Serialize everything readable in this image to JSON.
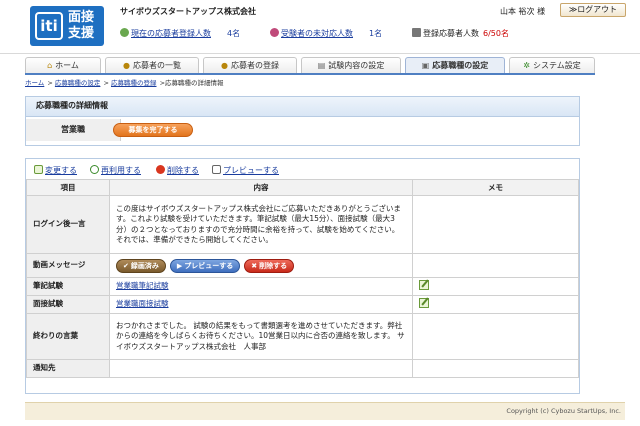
{
  "header": {
    "logo_mark": "iti",
    "logo_text_line1": "面接",
    "logo_text_line2": "支援",
    "company": "サイボウズスタートアップス株式会社",
    "user": "山本 裕次 様",
    "logout_label": "≫ログアウト"
  },
  "stats": {
    "current_applicants_label": "現在の応募者登録人数",
    "current_applicants_count": "4名",
    "unhandled_label": "受験者の未対応人数",
    "unhandled_count": "1名",
    "registered_label": "登録応募者人数",
    "registered_value": "6/50名"
  },
  "nav": {
    "tabs": [
      {
        "label": "ホーム",
        "icon": "home-icon"
      },
      {
        "label": "応募者の一覧",
        "icon": "people-icon"
      },
      {
        "label": "応募者の登録",
        "icon": "person-add-icon"
      },
      {
        "label": "試験内容の設定",
        "icon": "document-icon"
      },
      {
        "label": "応募職種の設定",
        "icon": "briefcase-icon"
      },
      {
        "label": "システム設定",
        "icon": "gear-icon"
      }
    ],
    "active_index": 4
  },
  "breadcrumb": {
    "home": "ホーム",
    "sep1": " > ",
    "role_settings": "応募職種の設定",
    "sep2": " > ",
    "role_register": "応募職種の登録",
    "current": " >応募職種の詳細情報"
  },
  "detail": {
    "title": "応募職種の詳細情報",
    "role_name": "営業職",
    "finish_button": "募集を完了する"
  },
  "actions": {
    "change": "変更する",
    "reuse": "再利用する",
    "delete": "削除する",
    "preview": "プレビューする"
  },
  "table": {
    "headers": [
      "項目",
      "内容",
      "メモ"
    ],
    "rows": {
      "login_msg_label": "ログイン後一言",
      "login_msg_text": "この度はサイボウズスタートアップス株式会社にご応募いただきありがとうございます。これより試験を受けていただきます。筆記試験（最大15分）、面接試験（最大3分）の２つとなっておりますので充分時間に余裕を持って、試験を始めてください。 それでは、準備ができたら開始してください。",
      "video_msg_label": "動画メッセージ",
      "video_recorded": "録画済み",
      "video_preview": "プレビューする",
      "video_delete": "削除する",
      "written_label": "筆記試験",
      "written_link": "営業職筆記試験",
      "interview_label": "面接試験",
      "interview_link": "営業職面接試験",
      "closing_label": "終わりの言葉",
      "closing_text": "おつかれさまでした。 試験の結果をもって書類選考を進めさせていただきます。弊社からの連絡を今しばらくお待ちください。10営業日以内に合否の連絡を致します。 サイボウズスタートアップス株式会社　人事部",
      "notify_label": "通知先",
      "notify_value": ""
    }
  },
  "footer": {
    "copyright": "Copyright (c) Cybozu StartUps, Inc."
  },
  "colors": {
    "brand_blue": "#1e6fc1",
    "accent_orange": "#e2741d",
    "count_red": "#cc0000",
    "link_blue": "#1a3d9e"
  }
}
